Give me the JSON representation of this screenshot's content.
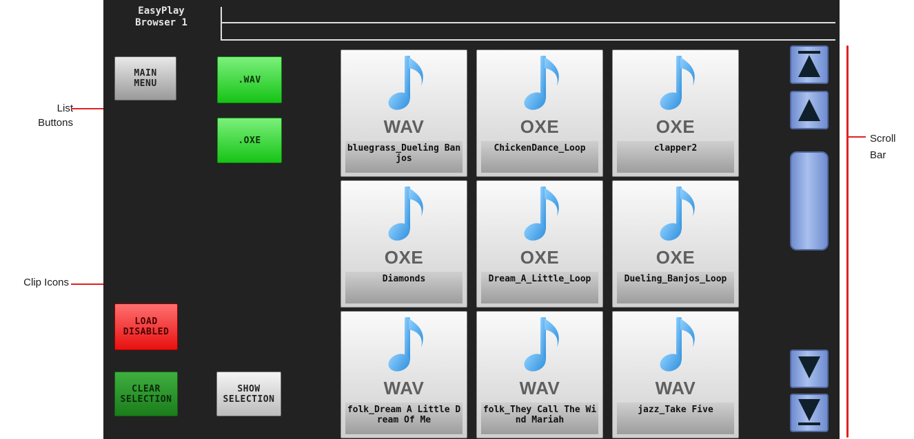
{
  "header": {
    "title_line1": "EasyPlay",
    "title_line2": "Browser 1"
  },
  "buttons": {
    "main_menu": "MAIN\nMENU",
    "wav": ".WAV",
    "oxe": ".OXE",
    "load_disabled": "LOAD\nDISABLED",
    "clear_selection": "CLEAR\nSELECTION",
    "show_selection": "SHOW\nSELECTION"
  },
  "clips": [
    {
      "ext": "WAV",
      "name": "bluegrass_Dueling Banjos"
    },
    {
      "ext": "OXE",
      "name": "ChickenDance_Loop"
    },
    {
      "ext": "OXE",
      "name": "clapper2"
    },
    {
      "ext": "OXE",
      "name": "Diamonds"
    },
    {
      "ext": "OXE",
      "name": "Dream_A_Little_Loop"
    },
    {
      "ext": "OXE",
      "name": "Dueling_Banjos_Loop"
    },
    {
      "ext": "WAV",
      "name": "folk_Dream A Little Dream Of Me"
    },
    {
      "ext": "WAV",
      "name": "folk_They Call The Wind Mariah"
    },
    {
      "ext": "WAV",
      "name": "jazz_Take Five"
    }
  ],
  "annotations": {
    "list_buttons": "List\nButtons",
    "clip_icons": "Clip Icons",
    "scroll_bar": "Scroll\nBar"
  },
  "icons": {
    "note": "music-note-icon",
    "top": "scroll-top-icon",
    "up": "scroll-up-icon",
    "down": "scroll-down-icon",
    "bottom": "scroll-bottom-icon"
  },
  "colors": {
    "background": "#222222",
    "note": "#4aa8ea",
    "red_annotation": "#e02020"
  }
}
